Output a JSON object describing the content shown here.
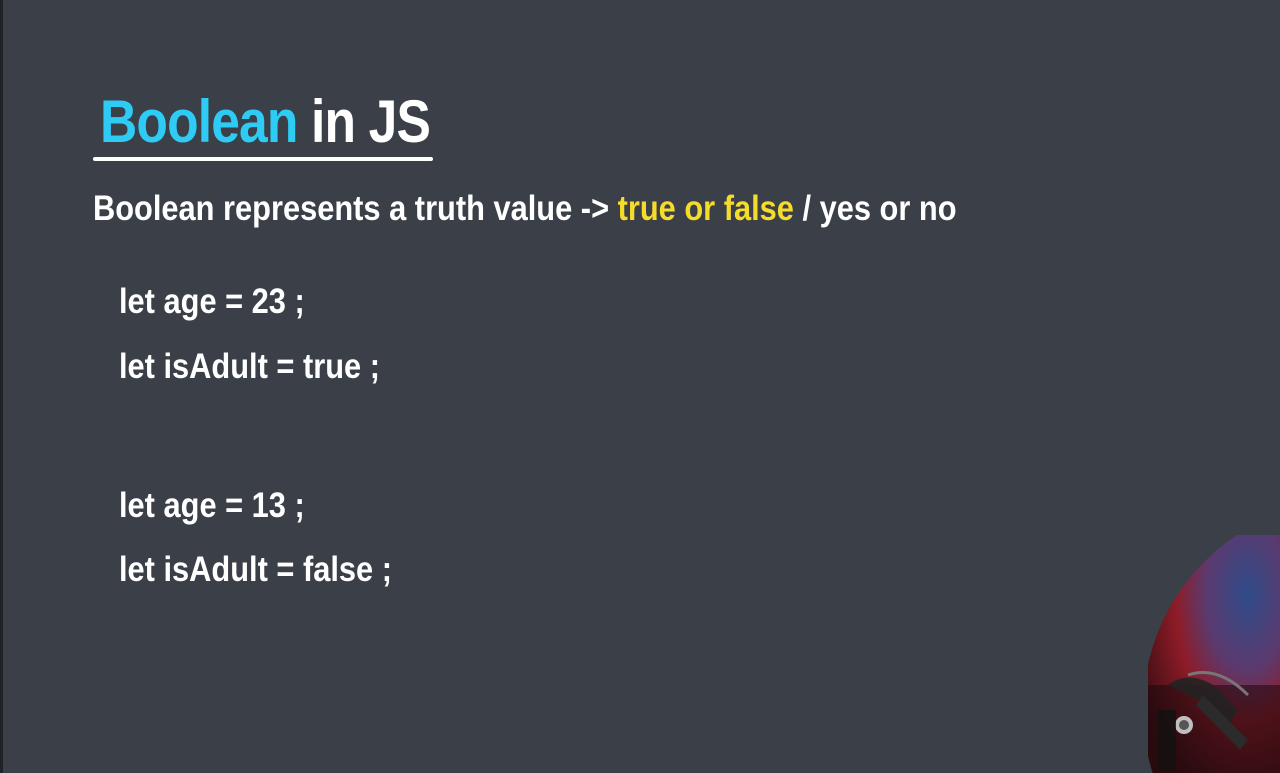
{
  "title": {
    "accent": "Boolean",
    "rest": " in JS"
  },
  "subtitle": {
    "before": "Boolean represents a truth value -> ",
    "highlight": "true or false",
    "after": " / yes or no"
  },
  "code_examples": [
    {
      "line": "let age = 23 ;"
    },
    {
      "line": "let isAdult = true ;"
    },
    {
      "line": "let age = 13 ;"
    },
    {
      "line": "let isAdult = false ;"
    }
  ],
  "colors": {
    "background": "#3a3f48",
    "title_accent": "#2ecbf5",
    "highlight": "#f5dc2a",
    "text": "#ffffff"
  }
}
